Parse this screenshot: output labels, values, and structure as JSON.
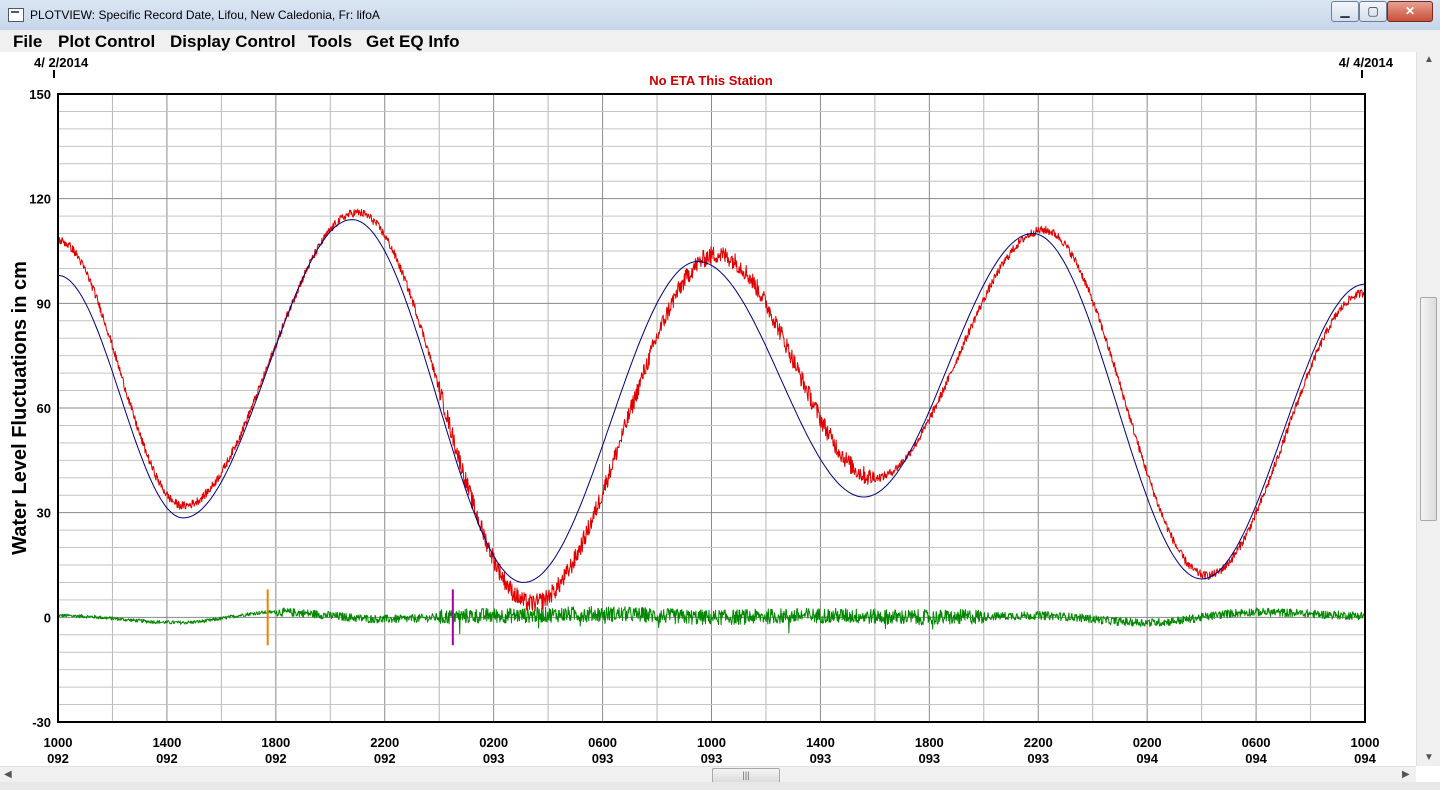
{
  "window": {
    "title": "PLOTVIEW: Specific Record Date, Lifou, New Caledonia, Fr: lifoA",
    "minimize_label": "▁",
    "maximize_label": "▢",
    "close_label": "✕"
  },
  "menu": [
    "File",
    "Plot Control",
    "Display Control",
    "Tools",
    "Get EQ Info"
  ],
  "scrollbar": {
    "grip_label": "|||"
  },
  "chart_data": {
    "type": "line",
    "title": "No ETA This Station",
    "ylabel": "Water Level Fluctuations in cm",
    "xlabel": "",
    "date_start_label": "4/ 2/2014",
    "date_end_label": "4/ 4/2014",
    "x_unit": "hours",
    "xlim": [
      0,
      48
    ],
    "ylim": [
      -30,
      150
    ],
    "yticks": [
      -30,
      0,
      30,
      60,
      90,
      120,
      150
    ],
    "ytick_labels": [
      "-30",
      "0",
      "30",
      "60",
      "90",
      "120",
      "150"
    ],
    "xticks": [
      {
        "x": 0,
        "time": "1000",
        "day": "092"
      },
      {
        "x": 4,
        "time": "1400",
        "day": "092"
      },
      {
        "x": 8,
        "time": "1800",
        "day": "092"
      },
      {
        "x": 12,
        "time": "2200",
        "day": "092"
      },
      {
        "x": 16,
        "time": "0200",
        "day": "093"
      },
      {
        "x": 20,
        "time": "0600",
        "day": "093"
      },
      {
        "x": 24,
        "time": "1000",
        "day": "093"
      },
      {
        "x": 28,
        "time": "1400",
        "day": "093"
      },
      {
        "x": 32,
        "time": "1800",
        "day": "093"
      },
      {
        "x": 36,
        "time": "2200",
        "day": "093"
      },
      {
        "x": 40,
        "time": "0200",
        "day": "094"
      },
      {
        "x": 44,
        "time": "0600",
        "day": "094"
      },
      {
        "x": 48,
        "time": "1000",
        "day": "094"
      }
    ],
    "grid": true,
    "series": [
      {
        "color": "#000080",
        "style": "predicted",
        "x": [
          0,
          4.6,
          10.8,
          17.1,
          23.5,
          29.6,
          35.8,
          42.0,
          48.0
        ],
        "y": [
          98,
          28.5,
          114,
          10,
          102,
          34.5,
          110,
          11,
          95.5
        ]
      },
      {
        "color": "#e00000",
        "style": "observed-noisy",
        "x": [
          0,
          4.6,
          11.0,
          17.4,
          24.2,
          30.0,
          36.2,
          42.2,
          48.0
        ],
        "y": [
          108,
          32,
          116,
          4,
          104,
          40,
          111,
          12,
          93
        ]
      },
      {
        "color": "#008800",
        "style": "residual",
        "x": [
          0,
          4.5,
          8.0,
          12.0,
          16.0,
          20.0,
          24.0,
          28.0,
          32.0,
          36.0,
          40.0,
          44.0,
          48.0
        ],
        "y": [
          0.5,
          -1.5,
          1.5,
          -0.5,
          0.5,
          1.0,
          0,
          0.5,
          0,
          0.5,
          -1.5,
          1.5,
          0.5
        ]
      }
    ],
    "markers": [
      {
        "x": 7.7,
        "color": "#f08000"
      },
      {
        "x": 14.5,
        "color": "#a000a0"
      }
    ]
  }
}
